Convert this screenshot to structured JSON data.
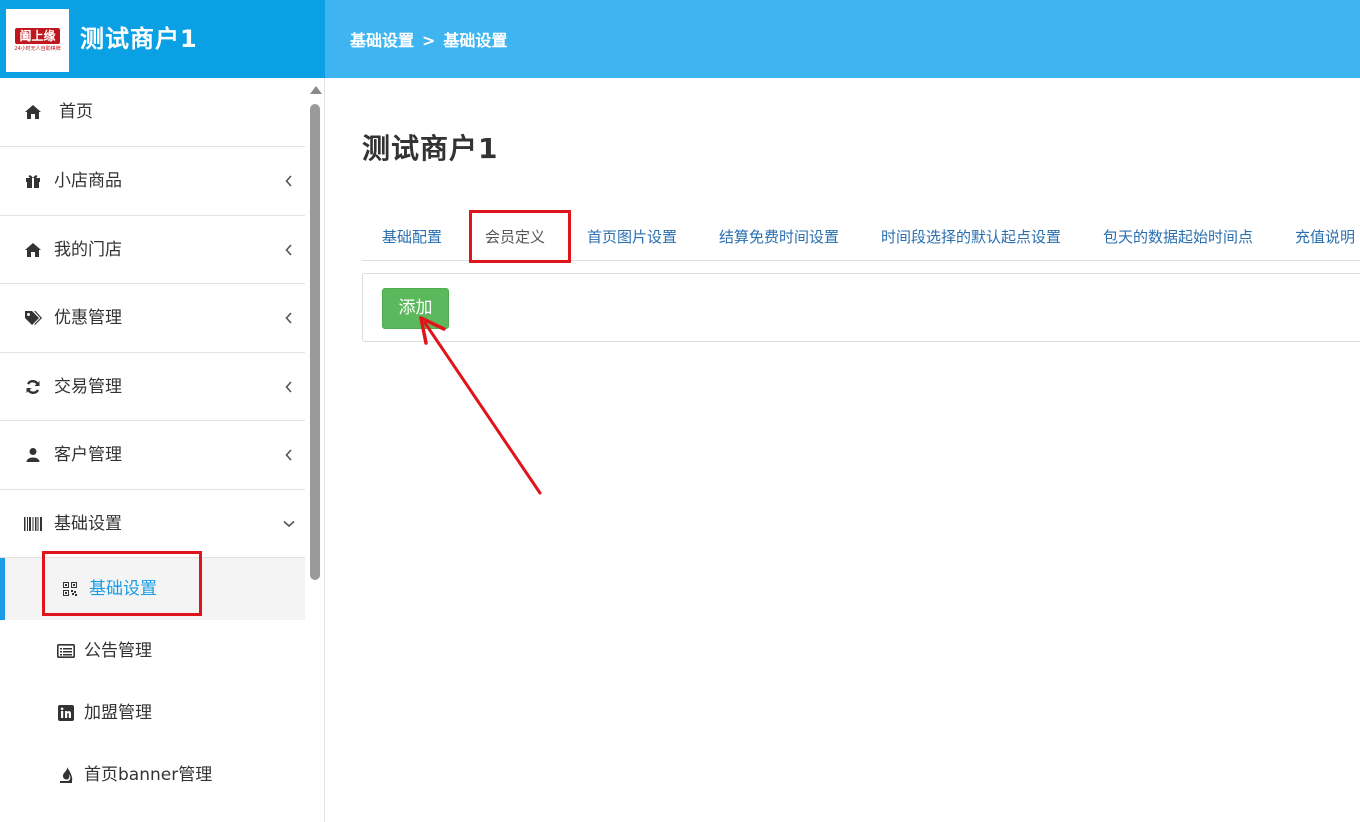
{
  "header": {
    "logo_text": "阖上缘",
    "logo_subtext": "24小时无人自助棋牌",
    "title": "测试商户1",
    "breadcrumb": [
      "基础设置",
      ">",
      "基础设置"
    ],
    "bg_color": "#3eb4f1",
    "brand_bg_color": "#0aa0e4"
  },
  "sidebar": {
    "items": [
      {
        "label": "首页",
        "icon": "home-icon",
        "chevron": "none"
      },
      {
        "label": "小店商品",
        "icon": "gift-icon",
        "chevron": "chevron-left-icon"
      },
      {
        "label": "我的门店",
        "icon": "home-icon",
        "chevron": "chevron-left-icon"
      },
      {
        "label": "优惠管理",
        "icon": "tags-icon",
        "chevron": "chevron-left-icon"
      },
      {
        "label": "交易管理",
        "icon": "refresh-icon",
        "chevron": "chevron-left-icon"
      },
      {
        "label": "客户管理",
        "icon": "user-icon",
        "chevron": "chevron-left-icon"
      },
      {
        "label": "基础设置",
        "icon": "barcode-icon",
        "chevron": "chevron-down-icon",
        "expanded": true
      }
    ],
    "sub_items": [
      {
        "label": "基础设置",
        "icon": "qrcode-icon",
        "active": true
      },
      {
        "label": "公告管理",
        "icon": "list-alt-icon"
      },
      {
        "label": "加盟管理",
        "icon": "linkedin-icon"
      },
      {
        "label": "首页banner管理",
        "icon": "fire-icon"
      }
    ],
    "active_color": "#1a9ce6"
  },
  "main": {
    "title": "测试商户1",
    "tabs": [
      {
        "label": "基础配置"
      },
      {
        "label": "会员定义",
        "active": true
      },
      {
        "label": "首页图片设置"
      },
      {
        "label": "结算免费时间设置"
      },
      {
        "label": "时间段选择的默认起点设置"
      },
      {
        "label": "包天的数据起始时间点"
      },
      {
        "label": "充值说明"
      }
    ],
    "add_button": "添加",
    "add_button_color": "#5cb85c",
    "tab_color": "#2a6fb0"
  },
  "annotations": {
    "highlight_color": "#e0141b"
  }
}
